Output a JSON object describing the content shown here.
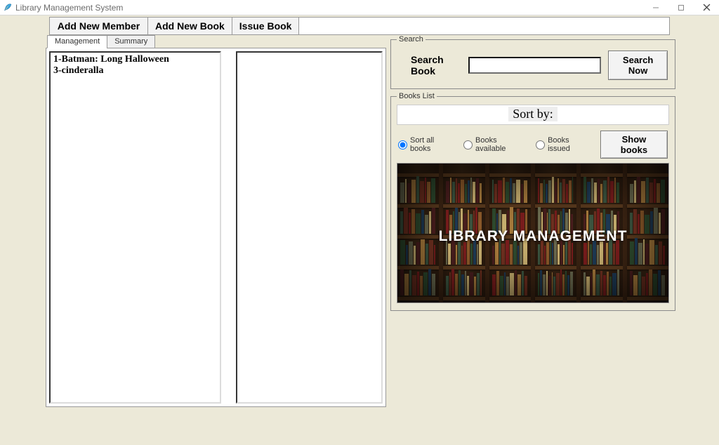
{
  "window": {
    "title": "Library Management System",
    "feather_icon": "feather-icon"
  },
  "toolbar": {
    "add_member": "Add New Member",
    "add_book": "Add New Book",
    "issue_book": "Issue Book"
  },
  "tabs": {
    "management": "Management",
    "summary": "Summary"
  },
  "left_list": [
    "1-Batman: Long Halloween",
    "3-cinderalla"
  ],
  "search": {
    "legend": "Search",
    "label": "Search Book",
    "value": "",
    "button": "Search Now"
  },
  "books_list": {
    "legend": "Books List",
    "sort_by": "Sort by:",
    "radios": {
      "all": "Sort all books",
      "available": "Books available",
      "issued": "Books issued"
    },
    "selected_radio": "all",
    "show_button": "Show books"
  },
  "image_caption": "LIBRARY MANAGEMENT"
}
